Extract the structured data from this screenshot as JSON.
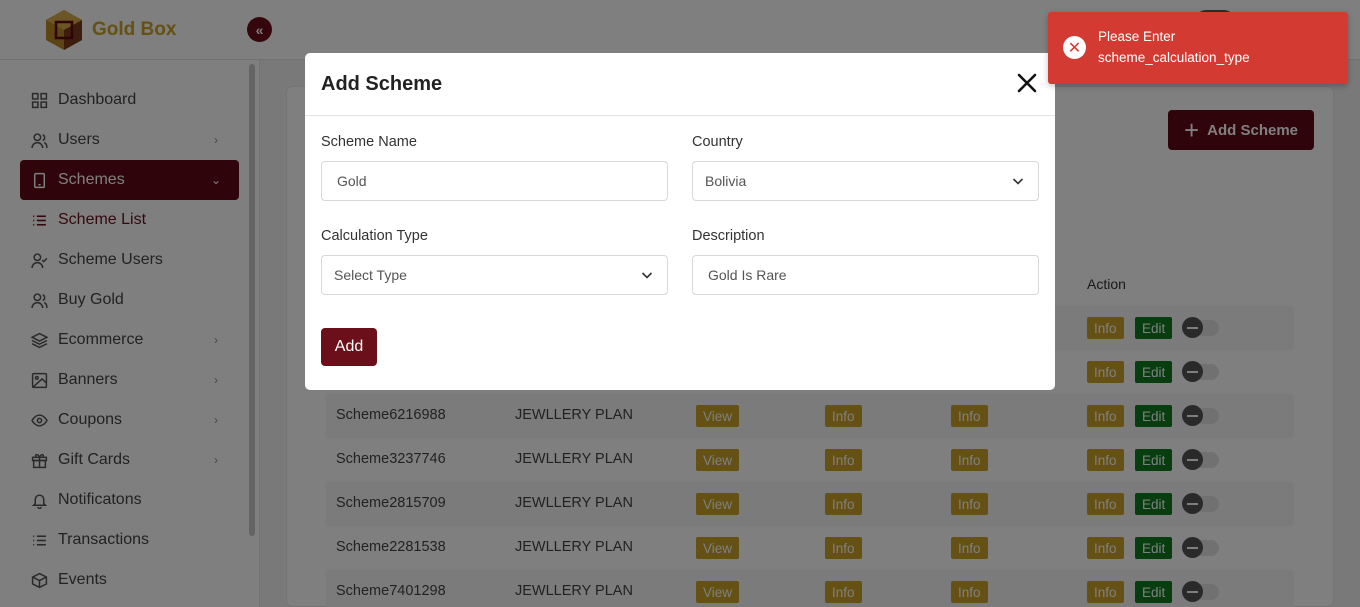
{
  "app": {
    "name": "Gold Box",
    "collapse_icon": "double-chevron-left-icon"
  },
  "colors": {
    "brand": "#6b0f1a",
    "gold": "#c9a227",
    "green": "#0f7a1f",
    "error": "#d23a32"
  },
  "sidebar": {
    "items": [
      {
        "label": "Dashboard",
        "icon": "grid-icon",
        "chevron": false
      },
      {
        "label": "Users",
        "icon": "users-icon",
        "chevron": true
      },
      {
        "label": "Schemes",
        "icon": "tablet-icon",
        "chevron": true,
        "active": true
      },
      {
        "label": "Scheme List",
        "icon": "list-icon",
        "chevron": false,
        "sub": true
      },
      {
        "label": "Scheme Users",
        "icon": "user-check-icon",
        "chevron": false
      },
      {
        "label": "Buy Gold",
        "icon": "users-icon",
        "chevron": false
      },
      {
        "label": "Ecommerce",
        "icon": "layers-icon",
        "chevron": true
      },
      {
        "label": "Banners",
        "icon": "image-icon",
        "chevron": true
      },
      {
        "label": "Coupons",
        "icon": "eye-icon",
        "chevron": true
      },
      {
        "label": "Gift Cards",
        "icon": "gift-icon",
        "chevron": true
      },
      {
        "label": "Notificatons",
        "icon": "bell-icon",
        "chevron": false
      },
      {
        "label": "Transactions",
        "icon": "list-icon",
        "chevron": false
      },
      {
        "label": "Events",
        "icon": "box-icon",
        "chevron": false
      }
    ]
  },
  "main": {
    "add_scheme_label": "Add Scheme",
    "action_header": "Action",
    "rows": [
      {
        "name": "",
        "plan": "",
        "partial": true
      },
      {
        "name": "",
        "plan": "",
        "partial": true
      },
      {
        "name": "Scheme6216988",
        "plan": "JEWLLERY PLAN"
      },
      {
        "name": "Scheme3237746",
        "plan": "JEWLLERY PLAN"
      },
      {
        "name": "Scheme2815709",
        "plan": "JEWLLERY PLAN"
      },
      {
        "name": "Scheme2281538",
        "plan": "JEWLLERY PLAN"
      },
      {
        "name": "Scheme7401298",
        "plan": "JEWLLERY PLAN"
      }
    ],
    "view_label": "View",
    "info_label": "Info",
    "edit_label": "Edit"
  },
  "modal": {
    "title": "Add Scheme",
    "scheme_name_label": "Scheme Name",
    "scheme_name_value": "Gold",
    "country_label": "Country",
    "country_value": "Bolivia",
    "calc_type_label": "Calculation Type",
    "calc_type_value": "Select Type",
    "description_label": "Description",
    "description_value": "Gold Is Rare",
    "submit_label": "Add"
  },
  "toast": {
    "line1": "Please Enter",
    "line2": "scheme_calculation_type",
    "icon": "error-x-icon"
  }
}
